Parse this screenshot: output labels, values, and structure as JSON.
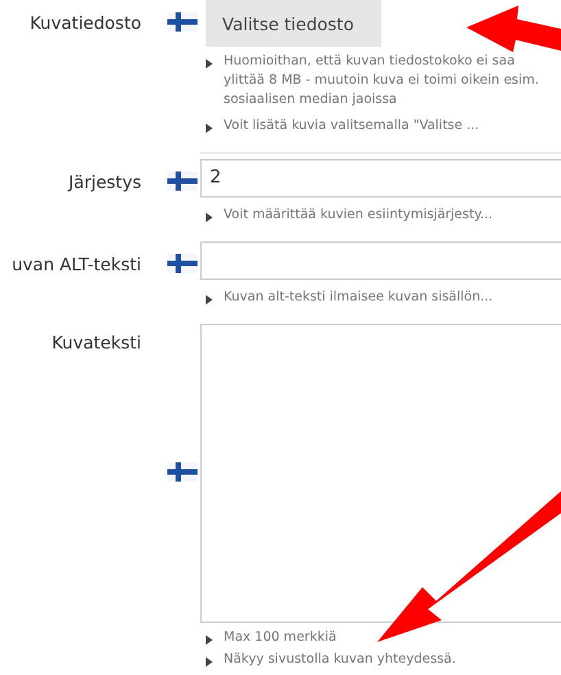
{
  "fields": [
    {
      "label": "Kuvatiedosto",
      "kind": "file",
      "button": "Valitse tiedosto",
      "help": [
        "Huomioithan, että kuvan tiedostokoko ei saa ylittää 8 MB - muutoin kuva ei toimi oikein esim. sosiaalisen median jaoissa",
        "Voit lisätä kuvia valitsemalla \"Valitse ..."
      ]
    },
    {
      "label": "Järjestys",
      "kind": "input",
      "value": "2",
      "help": [
        "Voit määrittää kuvien esiintymisjärjesty..."
      ]
    },
    {
      "label": "uvan ALT-teksti",
      "kind": "input",
      "help": [
        "Kuvan alt-teksti ilmaisee kuvan sisällön..."
      ]
    },
    {
      "label": "Kuvateksti",
      "kind": "textarea",
      "help": [
        "Max 100 merkkiä",
        "Näkyy sivustolla kuvan yhteydessä."
      ]
    }
  ]
}
